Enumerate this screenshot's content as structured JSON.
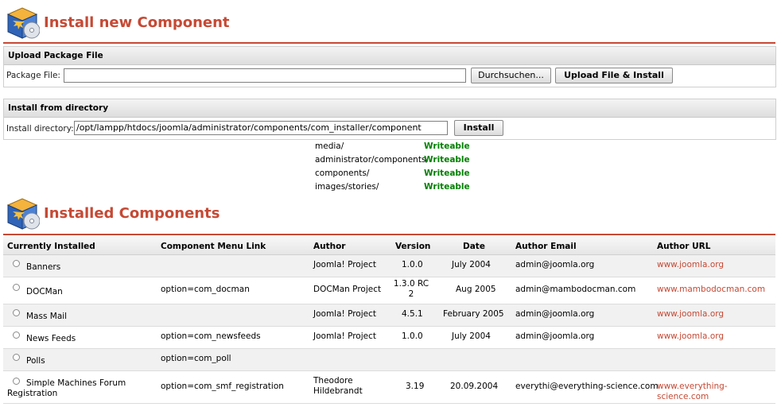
{
  "install_section": {
    "title": "Install new Component",
    "icon": "package-cd-icon"
  },
  "upload_panel": {
    "header": "Upload Package File",
    "label": "Package File:",
    "value": "",
    "browse_label": "Durchsuchen...",
    "submit_label": "Upload File & Install"
  },
  "directory_panel": {
    "header": "Install from directory",
    "label": "Install directory:",
    "value": "/opt/lampp/htdocs/joomla/administrator/components/com_installer/component",
    "submit_label": "Install"
  },
  "directories": [
    {
      "path": "media/",
      "status": "Writeable"
    },
    {
      "path": "administrator/components/",
      "status": "Writeable"
    },
    {
      "path": "components/",
      "status": "Writeable"
    },
    {
      "path": "images/stories/",
      "status": "Writeable"
    }
  ],
  "installed_section": {
    "title": "Installed Components",
    "icon": "package-cd-icon"
  },
  "table": {
    "headers": [
      "Currently Installed",
      "Component Menu Link",
      "Author",
      "Version",
      "Date",
      "Author Email",
      "Author URL"
    ],
    "rows": [
      {
        "name": "Banners",
        "link": "",
        "author": "Joomla! Project",
        "version": "1.0.0",
        "date": "July 2004",
        "email": "admin@joomla.org",
        "url": "www.joomla.org"
      },
      {
        "name": "DOCMan",
        "link": "option=com_docman",
        "author": "DOCMan Project",
        "version": "1.3.0 RC 2",
        "date": "Aug 2005",
        "email": "admin@mambodocman.com",
        "url": "www.mambodocman.com"
      },
      {
        "name": "Mass Mail",
        "link": "",
        "author": "Joomla! Project",
        "version": "4.5.1",
        "date": "February 2005",
        "email": "admin@joomla.org",
        "url": "www.joomla.org"
      },
      {
        "name": "News Feeds",
        "link": "option=com_newsfeeds",
        "author": "Joomla! Project",
        "version": "1.0.0",
        "date": "July 2004",
        "email": "admin@joomla.org",
        "url": "www.joomla.org"
      },
      {
        "name": "Polls",
        "link": "option=com_poll",
        "author": "",
        "version": "",
        "date": "",
        "email": "",
        "url": ""
      },
      {
        "name": "Simple Machines Forum Registration",
        "link": "option=com_smf_registration",
        "author": "Theodore Hildebrandt",
        "version": "3.19",
        "date": "20.09.2004",
        "email": "everythi@everything-science.com",
        "url": "www.everything-science.com"
      }
    ]
  },
  "colors": {
    "heading": "#c64934",
    "writeable": "#008000",
    "link": "#c64934"
  }
}
